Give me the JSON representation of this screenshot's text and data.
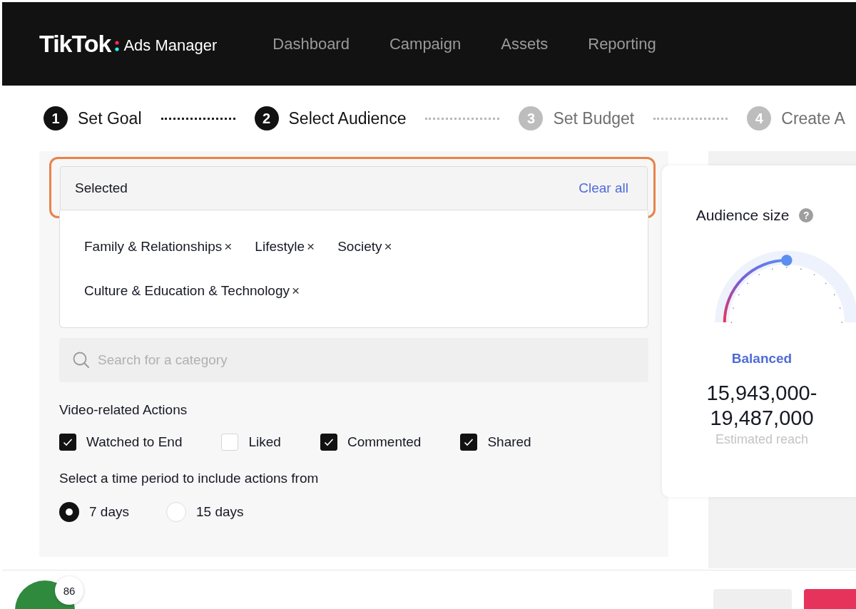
{
  "header": {
    "logo": "TikTok",
    "product": "Ads Manager",
    "nav": [
      {
        "label": "Dashboard",
        "selected": false
      },
      {
        "label": "Campaign",
        "selected": false
      },
      {
        "label": "Assets",
        "selected": false
      },
      {
        "label": "Reporting",
        "selected": false
      }
    ]
  },
  "steps": [
    {
      "number": "1",
      "label": "Set Goal",
      "active": true
    },
    {
      "number": "2",
      "label": "Select Audience",
      "active": true
    },
    {
      "number": "3",
      "label": "Set Budget",
      "active": false
    },
    {
      "number": "4",
      "label": "Create A",
      "active": false
    }
  ],
  "selected_box": {
    "title": "Selected",
    "clear": "Clear all",
    "tags": [
      {
        "label": "Family & Relationships",
        "remove": "×"
      },
      {
        "label": "Lifestyle",
        "remove": "×"
      },
      {
        "label": "Society",
        "remove": "×"
      },
      {
        "label": "Culture & Education & Technology",
        "remove": "×"
      }
    ]
  },
  "search": {
    "placeholder": "Search for a category"
  },
  "actions": {
    "title": "Video-related Actions",
    "options": [
      {
        "label": "Watched to End",
        "checked": true
      },
      {
        "label": "Liked",
        "checked": false
      },
      {
        "label": "Commented",
        "checked": true
      },
      {
        "label": "Shared",
        "checked": true
      }
    ]
  },
  "period": {
    "title": "Select a time period to include actions from",
    "options": [
      {
        "label": "7 days",
        "selected": true
      },
      {
        "label": "15 days",
        "selected": false
      }
    ]
  },
  "audience_size": {
    "title": "Audience size",
    "help": "?",
    "level": 0.5,
    "status": "Balanced",
    "reach": "15,943,000-\n19,487,000",
    "reach_label": "Estimated reach"
  },
  "progress_badge": {
    "count": "86"
  }
}
